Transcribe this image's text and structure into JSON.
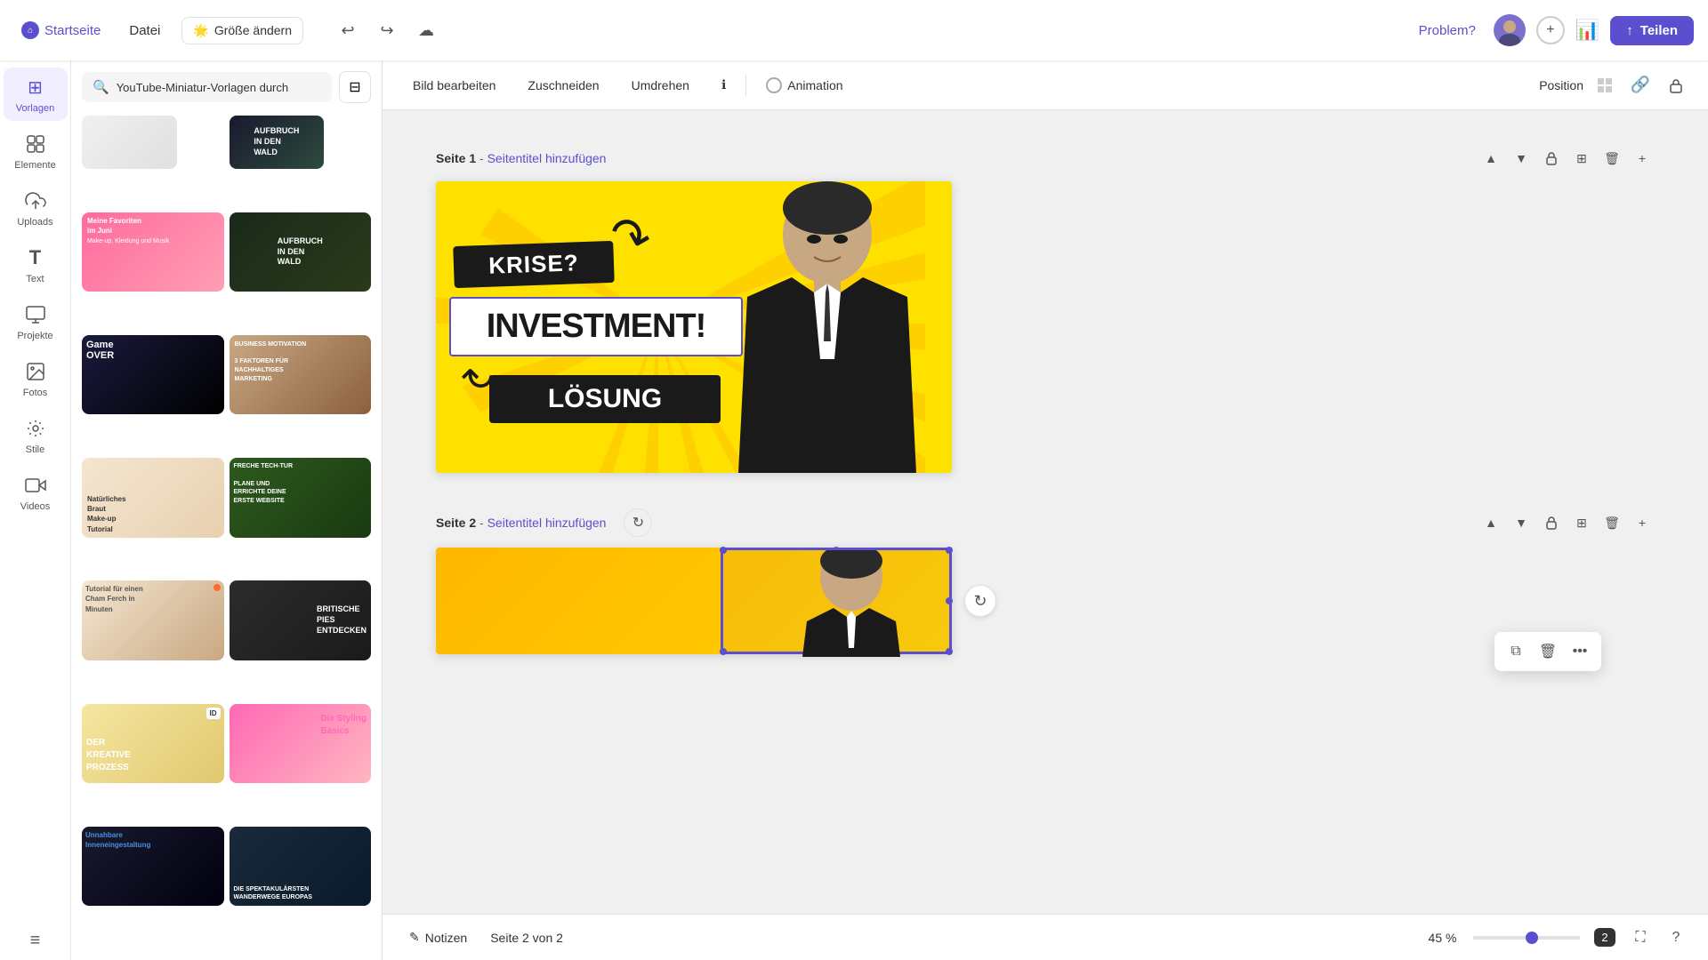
{
  "header": {
    "home_label": "Startseite",
    "file_label": "Datei",
    "resize_label": "Größe ändern",
    "undo_icon": "↩",
    "redo_icon": "↪",
    "cloud_icon": "☁",
    "problem_label": "Problem?",
    "share_label": "Teilen",
    "share_icon": "↑"
  },
  "sidebar": {
    "items": [
      {
        "id": "vorlagen",
        "label": "Vorlagen",
        "icon": "⊞",
        "active": true
      },
      {
        "id": "elemente",
        "label": "Elemente",
        "icon": "✦"
      },
      {
        "id": "uploads",
        "label": "Uploads",
        "icon": "⬆"
      },
      {
        "id": "text",
        "label": "Text",
        "icon": "T"
      },
      {
        "id": "projekte",
        "label": "Projekte",
        "icon": "▦"
      },
      {
        "id": "fotos",
        "label": "Fotos",
        "icon": "🖼"
      },
      {
        "id": "stile",
        "label": "Stile",
        "icon": "✿"
      },
      {
        "id": "videos",
        "label": "Videos",
        "icon": "▶"
      }
    ]
  },
  "search": {
    "placeholder": "YouTube-Miniatur-Vorlagen durch",
    "filter_icon": "⊟"
  },
  "toolbar": {
    "edit_image": "Bild bearbeiten",
    "crop": "Zuschneiden",
    "flip": "Umdrehen",
    "info_icon": "ℹ",
    "animation": "Animation",
    "position": "Position"
  },
  "pages": [
    {
      "id": "page1",
      "title": "Seite 1",
      "add_title": "Seitentitel hinzufügen",
      "content": {
        "headline1": "KRISE?",
        "headline2": "INVESTMENT!",
        "headline3": "LÖSUNG"
      }
    },
    {
      "id": "page2",
      "title": "Seite 2",
      "add_title": "Seitentitel hinzufügen"
    }
  ],
  "bottom_bar": {
    "notes_label": "Notizen",
    "notes_icon": "✎",
    "page_info": "Seite 2 von 2",
    "zoom_value": "45 %"
  },
  "context_menu": {
    "copy_icon": "⧉",
    "delete_icon": "🗑",
    "more_icon": "…"
  },
  "templates": [
    {
      "id": "t1",
      "style": "tc-1",
      "text": ""
    },
    {
      "id": "t2",
      "style": "tc-2",
      "text": "AUFBRUCH IN DEN WALD"
    },
    {
      "id": "t3",
      "style": "tc-3",
      "text": "Meine Favoriten im Juni"
    },
    {
      "id": "t4",
      "style": "tc-4",
      "text": "3 FAKTOREN FÜR NACHHALTIGES MARKETING"
    },
    {
      "id": "t5",
      "style": "tc-5",
      "text": "Game OVER"
    },
    {
      "id": "t6",
      "style": "tc-6",
      "text": ""
    },
    {
      "id": "t7",
      "style": "tc-7",
      "text": "Natürliches Braut Make-up Tutorial"
    },
    {
      "id": "t8",
      "style": "tc-8",
      "text": "PLANE UND ERRICHTE DEINE ERSTE WEBSITE"
    },
    {
      "id": "t9",
      "style": "tc-9",
      "text": "Tutorial für einen Cham..."
    },
    {
      "id": "t10",
      "style": "tc-10",
      "text": "BRITISCHE PIES ENTDECKEN"
    },
    {
      "id": "t11",
      "style": "tc-11",
      "text": "Die Styling Basics"
    },
    {
      "id": "t12",
      "style": "tc-12",
      "text": "DER KREATIVE PROZESS"
    },
    {
      "id": "t13",
      "style": "tc-13",
      "text": "DIE SPEKTAKULÄRSTEN WANDERWEGE EUROPAS"
    },
    {
      "id": "t14",
      "style": "tc-14",
      "text": "Unnahbare Innengestaltung"
    }
  ]
}
